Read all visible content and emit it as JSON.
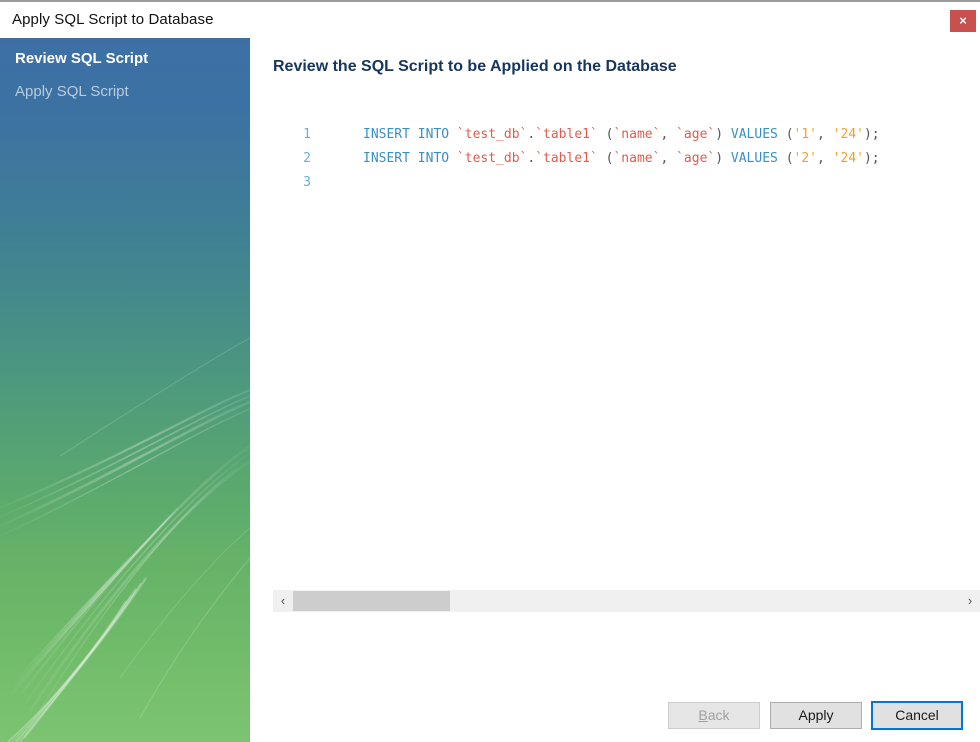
{
  "window": {
    "title": "Apply SQL Script to Database",
    "close_label": "×",
    "close_icon": "close-icon",
    "close_color": "#c9504f"
  },
  "sidebar": {
    "gradient_from": "#3d6fa5",
    "gradient_to": "#7cc471",
    "items": [
      {
        "label": "Review SQL Script",
        "state": "active"
      },
      {
        "label": "Apply SQL Script",
        "state": "pending"
      }
    ]
  },
  "content": {
    "heading": "Review the SQL Script to be Applied on the Database",
    "heading_color": "#17365d"
  },
  "editor": {
    "gutter_color": "#6aaed6",
    "keyword_color": "#3a8fc4",
    "identifier_color": "#e05c4e",
    "string_color": "#f0a030",
    "lines": [
      {
        "number": "1",
        "text": "INSERT INTO `test_db`.`table1` (`name`, `age`) VALUES ('1', '24');",
        "tokens": [
          {
            "t": "INSERT INTO ",
            "k": "kw"
          },
          {
            "t": "`test_db`",
            "k": "id"
          },
          {
            "t": ".",
            "k": "punc"
          },
          {
            "t": "`table1`",
            "k": "id"
          },
          {
            "t": " (",
            "k": "punc"
          },
          {
            "t": "`name`",
            "k": "id"
          },
          {
            "t": ", ",
            "k": "punc"
          },
          {
            "t": "`age`",
            "k": "id"
          },
          {
            "t": ") ",
            "k": "punc"
          },
          {
            "t": "VALUES",
            "k": "kw"
          },
          {
            "t": " (",
            "k": "punc"
          },
          {
            "t": "'1'",
            "k": "str"
          },
          {
            "t": ", ",
            "k": "punc"
          },
          {
            "t": "'24'",
            "k": "str"
          },
          {
            "t": ");",
            "k": "punc"
          }
        ]
      },
      {
        "number": "2",
        "text": "INSERT INTO `test_db`.`table1` (`name`, `age`) VALUES ('2', '24');",
        "tokens": [
          {
            "t": "INSERT INTO ",
            "k": "kw"
          },
          {
            "t": "`test_db`",
            "k": "id"
          },
          {
            "t": ".",
            "k": "punc"
          },
          {
            "t": "`table1`",
            "k": "id"
          },
          {
            "t": " (",
            "k": "punc"
          },
          {
            "t": "`name`",
            "k": "id"
          },
          {
            "t": ", ",
            "k": "punc"
          },
          {
            "t": "`age`",
            "k": "id"
          },
          {
            "t": ") ",
            "k": "punc"
          },
          {
            "t": "VALUES",
            "k": "kw"
          },
          {
            "t": " (",
            "k": "punc"
          },
          {
            "t": "'2'",
            "k": "str"
          },
          {
            "t": ", ",
            "k": "punc"
          },
          {
            "t": "'24'",
            "k": "str"
          },
          {
            "t": ");",
            "k": "punc"
          }
        ]
      },
      {
        "number": "3",
        "text": "",
        "tokens": []
      }
    ]
  },
  "scrollbar": {
    "left_arrow": "‹",
    "right_arrow": "›",
    "thumb_color": "#cdcdcd",
    "track_color": "#f0f0f0"
  },
  "footer": {
    "back_label": "Back",
    "back_mnemonic": "B",
    "back_rest": "ack",
    "back_enabled": "false",
    "apply_label": "Apply",
    "cancel_label": "Cancel",
    "focus_color": "#0078d7"
  }
}
